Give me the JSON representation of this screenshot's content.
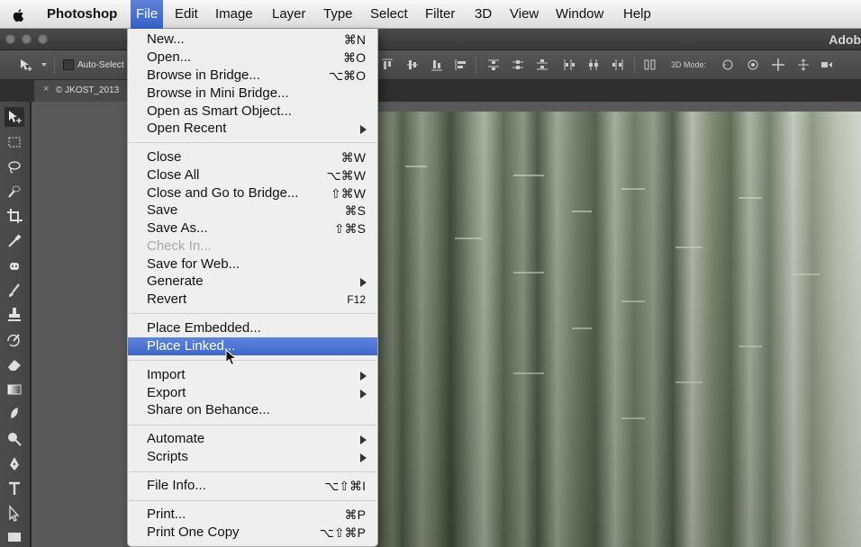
{
  "menubar": {
    "apple_icon": "apple-icon",
    "items": [
      {
        "label": "Photoshop",
        "bold": true
      },
      {
        "label": "File",
        "active": true
      },
      {
        "label": "Edit"
      },
      {
        "label": "Image"
      },
      {
        "label": "Layer"
      },
      {
        "label": "Type"
      },
      {
        "label": "Select"
      },
      {
        "label": "Filter"
      },
      {
        "label": "3D"
      },
      {
        "label": "View"
      },
      {
        "label": "Window"
      },
      {
        "label": "Help"
      }
    ]
  },
  "appbar": {
    "title": "Adob"
  },
  "options_bar": {
    "auto_select_label": "Auto-Select",
    "mode_label": "3D Mode:"
  },
  "document": {
    "tab_label": "© JKOST_2013",
    "close_glyph": "×",
    "grip_glyph": "»"
  },
  "tools": [
    "move-tool-icon",
    "marquee-tool-icon",
    "lasso-tool-icon",
    "quick-select-tool-icon",
    "crop-tool-icon",
    "eyedropper-tool-icon",
    "healing-brush-tool-icon",
    "brush-tool-icon",
    "clone-stamp-tool-icon",
    "history-brush-tool-icon",
    "eraser-tool-icon",
    "gradient-tool-icon",
    "blur-tool-icon",
    "dodge-tool-icon",
    "pen-tool-icon",
    "type-tool-icon",
    "path-select-tool-icon",
    "rectangle-tool-icon"
  ],
  "file_menu": {
    "items": [
      {
        "label": "New...",
        "shortcut": "⌘N"
      },
      {
        "label": "Open...",
        "shortcut": "⌘O"
      },
      {
        "label": "Browse in Bridge...",
        "shortcut": "⌥⌘O"
      },
      {
        "label": "Browse in Mini Bridge...",
        "shortcut": ""
      },
      {
        "label": "Open as Smart Object...",
        "shortcut": ""
      },
      {
        "label": "Open Recent",
        "submenu": true
      },
      {
        "separator": true
      },
      {
        "label": "Close",
        "shortcut": "⌘W"
      },
      {
        "label": "Close All",
        "shortcut": "⌥⌘W"
      },
      {
        "label": "Close and Go to Bridge...",
        "shortcut": "⇧⌘W"
      },
      {
        "label": "Save",
        "shortcut": "⌘S"
      },
      {
        "label": "Save As...",
        "shortcut": "⇧⌘S"
      },
      {
        "label": "Check In...",
        "disabled": true
      },
      {
        "label": "Save for Web...",
        "shortcut": ""
      },
      {
        "label": "Generate",
        "submenu": true
      },
      {
        "label": "Revert",
        "shortcut": "F12"
      },
      {
        "separator": true
      },
      {
        "label": "Place Embedded...",
        "shortcut": ""
      },
      {
        "label": "Place Linked...",
        "highlighted": true
      },
      {
        "separator": true
      },
      {
        "label": "Import",
        "submenu": true
      },
      {
        "label": "Export",
        "submenu": true
      },
      {
        "label": "Share on Behance...",
        "shortcut": ""
      },
      {
        "separator": true
      },
      {
        "label": "Automate",
        "submenu": true
      },
      {
        "label": "Scripts",
        "submenu": true
      },
      {
        "separator": true
      },
      {
        "label": "File Info...",
        "shortcut": "⌥⇧⌘I"
      },
      {
        "separator": true
      },
      {
        "label": "Print...",
        "shortcut": "⌘P"
      },
      {
        "label": "Print One Copy",
        "shortcut": "⌥⇧⌘P"
      }
    ]
  },
  "colors": {
    "menu_highlight": "#3e68cb",
    "panel_dark": "#474747"
  }
}
